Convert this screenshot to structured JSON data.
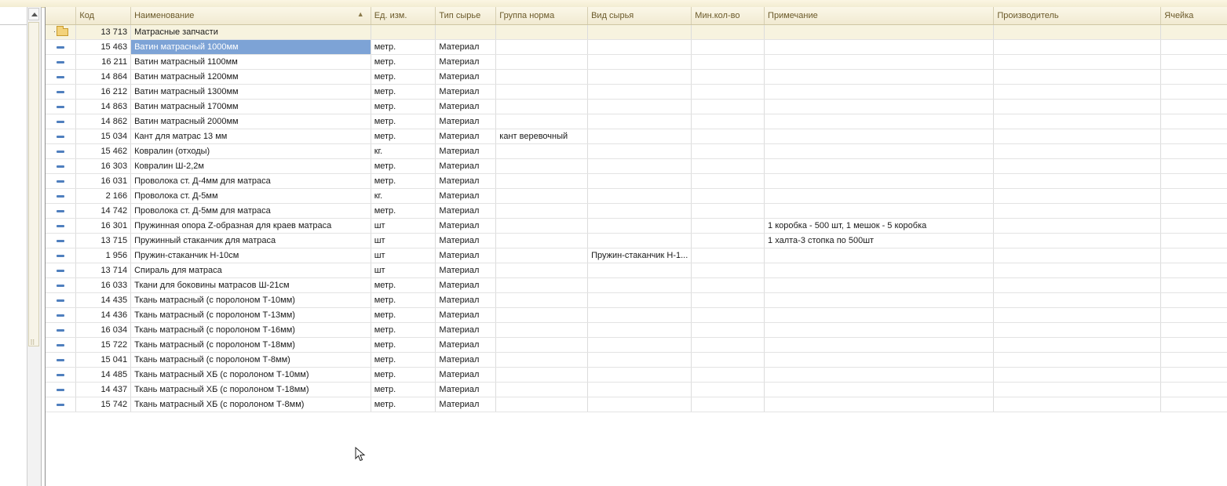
{
  "columns": [
    "",
    "Код",
    "Наименование",
    "Ед. изм.",
    "Тип сырье",
    "Группа норма",
    "Вид сырья",
    "Мин.кол-во",
    "Примечание",
    "Производитель",
    "Ячейка"
  ],
  "group": {
    "code": "13 713",
    "name": "Матрасные запчасти"
  },
  "rows": [
    {
      "code": "15 463",
      "name": "Ватин матрасный 1000мм",
      "unit": "метр.",
      "type": "Материал",
      "group_norm": "",
      "kind": "",
      "min_qty": "",
      "note": "",
      "maker": "",
      "cell": ""
    },
    {
      "code": "16 211",
      "name": "Ватин матрасный 1100мм",
      "unit": "метр.",
      "type": "Материал",
      "group_norm": "",
      "kind": "",
      "min_qty": "",
      "note": "",
      "maker": "",
      "cell": ""
    },
    {
      "code": "14 864",
      "name": "Ватин матрасный 1200мм",
      "unit": "метр.",
      "type": "Материал",
      "group_norm": "",
      "kind": "",
      "min_qty": "",
      "note": "",
      "maker": "",
      "cell": ""
    },
    {
      "code": "16 212",
      "name": "Ватин матрасный 1300мм",
      "unit": "метр.",
      "type": "Материал",
      "group_norm": "",
      "kind": "",
      "min_qty": "",
      "note": "",
      "maker": "",
      "cell": ""
    },
    {
      "code": "14 863",
      "name": "Ватин матрасный 1700мм",
      "unit": "метр.",
      "type": "Материал",
      "group_norm": "",
      "kind": "",
      "min_qty": "",
      "note": "",
      "maker": "",
      "cell": ""
    },
    {
      "code": "14 862",
      "name": "Ватин матрасный 2000мм",
      "unit": "метр.",
      "type": "Материал",
      "group_norm": "",
      "kind": "",
      "min_qty": "",
      "note": "",
      "maker": "",
      "cell": ""
    },
    {
      "code": "15 034",
      "name": "Кант для матрас  13 мм",
      "unit": "метр.",
      "type": "Материал",
      "group_norm": "кант веревочный",
      "kind": "",
      "min_qty": "",
      "note": "",
      "maker": "",
      "cell": ""
    },
    {
      "code": "15 462",
      "name": "Ковралин (отходы)",
      "unit": "кг.",
      "type": "Материал",
      "group_norm": "",
      "kind": "",
      "min_qty": "",
      "note": "",
      "maker": "",
      "cell": ""
    },
    {
      "code": "16 303",
      "name": "Ковралин Ш-2,2м",
      "unit": "метр.",
      "type": "Материал",
      "group_norm": "",
      "kind": "",
      "min_qty": "",
      "note": "",
      "maker": "",
      "cell": ""
    },
    {
      "code": "16 031",
      "name": "Проволока ст. Д-4мм для матраса",
      "unit": "метр.",
      "type": "Материал",
      "group_norm": "",
      "kind": "",
      "min_qty": "",
      "note": "",
      "maker": "",
      "cell": ""
    },
    {
      "code": "2 166",
      "name": "Проволока ст. Д-5мм",
      "unit": "кг.",
      "type": "Материал",
      "group_norm": "",
      "kind": "",
      "min_qty": "",
      "note": "",
      "maker": "",
      "cell": ""
    },
    {
      "code": "14 742",
      "name": "Проволока ст. Д-5мм для матраса",
      "unit": "метр.",
      "type": "Материал",
      "group_norm": "",
      "kind": "",
      "min_qty": "",
      "note": "",
      "maker": "",
      "cell": ""
    },
    {
      "code": "16 301",
      "name": "Пружинная опора Z-образная для краев матраса",
      "unit": "шт",
      "type": "Материал",
      "group_norm": "",
      "kind": "",
      "min_qty": "",
      "note": "1 коробка - 500 шт, 1 мешок - 5 коробка",
      "maker": "",
      "cell": ""
    },
    {
      "code": "13 715",
      "name": "Пружинный стаканчик для матраса",
      "unit": "шт",
      "type": "Материал",
      "group_norm": "",
      "kind": "",
      "min_qty": "",
      "note": "1 халта-3 стопка по 500шт",
      "maker": "",
      "cell": ""
    },
    {
      "code": "1 956",
      "name": "Пружин-стаканчик Н-10см",
      "unit": "шт",
      "type": "Материал",
      "group_norm": "",
      "kind": "Пружин-стаканчик Н-1...",
      "min_qty": "",
      "note": "",
      "maker": "",
      "cell": ""
    },
    {
      "code": "13 714",
      "name": "Спираль для матраса",
      "unit": "шт",
      "type": "Материал",
      "group_norm": "",
      "kind": "",
      "min_qty": "",
      "note": "",
      "maker": "",
      "cell": ""
    },
    {
      "code": "16 033",
      "name": "Ткани для боковины матрасов Ш-21см",
      "unit": "метр.",
      "type": "Материал",
      "group_norm": "",
      "kind": "",
      "min_qty": "",
      "note": "",
      "maker": "",
      "cell": ""
    },
    {
      "code": "14 435",
      "name": "Ткань матрасный (с поролоном Т-10мм)",
      "unit": "метр.",
      "type": "Материал",
      "group_norm": "",
      "kind": "",
      "min_qty": "",
      "note": "",
      "maker": "",
      "cell": ""
    },
    {
      "code": "14 436",
      "name": "Ткань матрасный (с поролоном Т-13мм)",
      "unit": "метр.",
      "type": "Материал",
      "group_norm": "",
      "kind": "",
      "min_qty": "",
      "note": "",
      "maker": "",
      "cell": ""
    },
    {
      "code": "16 034",
      "name": "Ткань матрасный (с поролоном Т-16мм)",
      "unit": "метр.",
      "type": "Материал",
      "group_norm": "",
      "kind": "",
      "min_qty": "",
      "note": "",
      "maker": "",
      "cell": ""
    },
    {
      "code": "15 722",
      "name": "Ткань матрасный (с поролоном Т-18мм)",
      "unit": "метр.",
      "type": "Материал",
      "group_norm": "",
      "kind": "",
      "min_qty": "",
      "note": "",
      "maker": "",
      "cell": ""
    },
    {
      "code": "15 041",
      "name": "Ткань матрасный (с поролоном Т-8мм)",
      "unit": "метр.",
      "type": "Материал",
      "group_norm": "",
      "kind": "",
      "min_qty": "",
      "note": "",
      "maker": "",
      "cell": ""
    },
    {
      "code": "14 485",
      "name": "Ткань матрасный ХБ (с поролоном Т-10мм)",
      "unit": "метр.",
      "type": "Материал",
      "group_norm": "",
      "kind": "",
      "min_qty": "",
      "note": "",
      "maker": "",
      "cell": ""
    },
    {
      "code": "14 437",
      "name": "Ткань матрасный ХБ (с поролоном Т-18мм)",
      "unit": "метр.",
      "type": "Материал",
      "group_norm": "",
      "kind": "",
      "min_qty": "",
      "note": "",
      "maker": "",
      "cell": ""
    },
    {
      "code": "15 742",
      "name": "Ткань матрасный ХБ (с поролоном Т-8мм)",
      "unit": "метр.",
      "type": "Материал",
      "group_norm": "",
      "kind": "",
      "min_qty": "",
      "note": "",
      "maker": "",
      "cell": ""
    }
  ],
  "selected_row": 0,
  "icons": {
    "group": "folder-icon",
    "item": "dash-icon",
    "sort": "sort-ascending-icon",
    "scroll_up": "scroll-up-arrow-icon",
    "cursor": "mouse-cursor-icon"
  },
  "colors": {
    "selection": "#7da3d6",
    "header_text": "#6b5a2a",
    "group_row": "#f7f3df"
  }
}
